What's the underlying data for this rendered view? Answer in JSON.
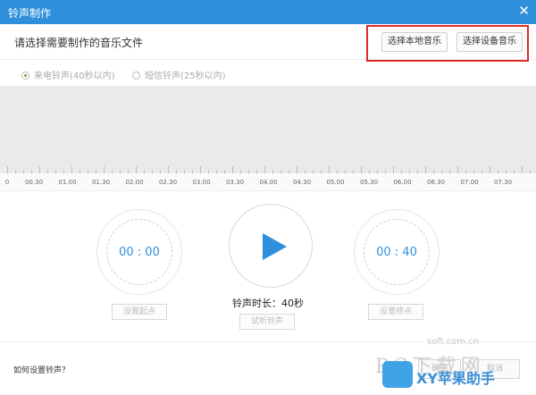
{
  "window": {
    "title": "铃声制作",
    "close_glyph": "✕"
  },
  "header": {
    "prompt": "请选择需要制作的音乐文件",
    "btn_local": "选择本地音乐",
    "btn_device": "选择设备音乐"
  },
  "ringtype": {
    "call": "来电铃声(40秒以内)",
    "sms": "短信铃声(25秒以内)",
    "selected": "call"
  },
  "timeline": {
    "labels": [
      "0",
      "00.30",
      "01.00",
      "01.30",
      "02.00",
      "02.30",
      "03.00",
      "03.30",
      "04.00",
      "04.30",
      "05.00",
      "05.30",
      "06.00",
      "06.30",
      "07.00",
      "07.30"
    ]
  },
  "start": {
    "time": "00 : 00",
    "button": "设置起点"
  },
  "end": {
    "time": "00 : 40",
    "button": "设置终点"
  },
  "player": {
    "duration_text": "铃声时长：40秒",
    "preview_button": "试听铃声"
  },
  "footer": {
    "help": "如何设置铃声？",
    "ok": "确定",
    "cancel": "取消"
  },
  "watermark": {
    "site": "soft.com.cn",
    "big": "PC下载网",
    "app": "XY苹果助手"
  },
  "colors": {
    "titlebar": "#2f8fda",
    "accent": "#2f8fda",
    "highlight": "#e02a2a"
  },
  "icons": {
    "play": "play-icon",
    "close": "close-icon"
  }
}
